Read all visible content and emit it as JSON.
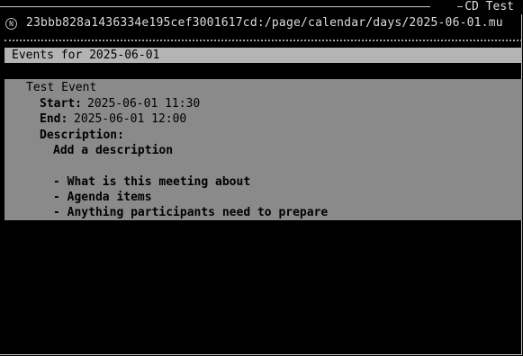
{
  "window": {
    "title": "CD Test"
  },
  "url_bar": {
    "icon": "node-icon",
    "icon_glyph": "N",
    "address": "23bbb828a1436334e195cef3001617cd:/page/calendar/days/2025-06-01.mu"
  },
  "heading": "Events for 2025-06-01",
  "event": {
    "name": "Test Event",
    "start_label": "Start:",
    "start_value": "2025-06-01 11:30",
    "end_label": "End:",
    "end_value": "2025-06-01 12:00",
    "description_label": "Description:",
    "description_lines": [
      "Add a description",
      "- What is this meeting about",
      "- Agenda items",
      "- Anything participants need to prepare"
    ]
  },
  "colors": {
    "background": "#000000",
    "heading_bar": "#b4b4b4",
    "content_bg": "#8a8a8a",
    "text_light": "#d7d7d7",
    "text_dark": "#000000"
  }
}
